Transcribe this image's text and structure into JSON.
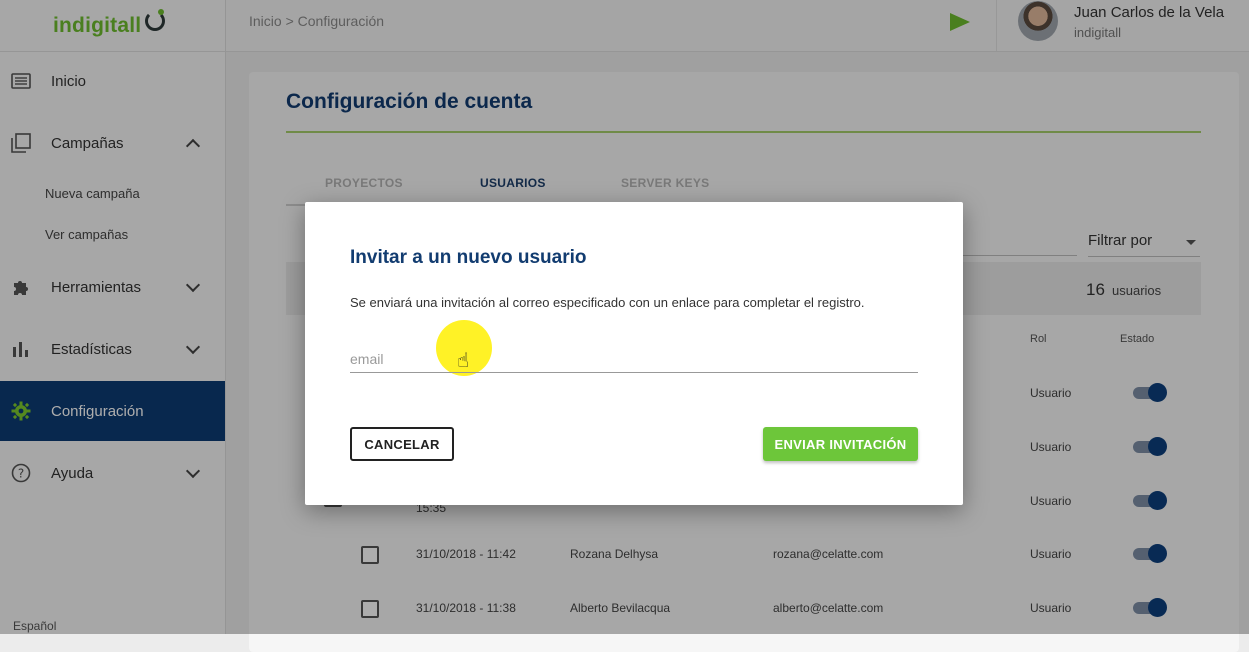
{
  "logo": {
    "text": "indigitall"
  },
  "breadcrumb": "Inicio > Configuración",
  "user": {
    "name": "Juan Carlos de la Vela",
    "org": "indigitall"
  },
  "sidebar": {
    "items": [
      {
        "label": "Inicio",
        "icon": "list-icon"
      },
      {
        "label": "Campañas",
        "icon": "copy-icon",
        "sub": [
          "Nueva campaña",
          "Ver campañas"
        ]
      },
      {
        "label": "Herramientas",
        "icon": "puzzle-icon"
      },
      {
        "label": "Estadísticas",
        "icon": "bar-chart-icon"
      },
      {
        "label": "Configuración",
        "icon": "gear-icon"
      },
      {
        "label": "Ayuda",
        "icon": "help-icon"
      }
    ],
    "language": "Español"
  },
  "main": {
    "title": "Configuración de cuenta",
    "tabs": [
      "PROYECTOS",
      "USUARIOS",
      "SERVER KEYS"
    ],
    "filter": "Filtrar por",
    "count": {
      "value": "16",
      "label": "usuarios"
    },
    "columns": {
      "rol": "Rol",
      "estado": "Estado"
    },
    "rows": [
      {
        "date": "",
        "name": "",
        "email": "",
        "rol": "Usuario",
        "active": true
      },
      {
        "date": "",
        "name": "",
        "email": "",
        "rol": "Usuario",
        "active": true
      },
      {
        "date": "15:35",
        "name": "",
        "email": "",
        "rol": "Usuario",
        "active": true
      },
      {
        "date": "31/10/2018 - 11:42",
        "name": "Rozana Delhysa",
        "email": "rozana@celatte.com",
        "rol": "Usuario",
        "active": true
      },
      {
        "date": "31/10/2018 - 11:38",
        "name": "Alberto Bevilacqua",
        "email": "alberto@celatte.com",
        "rol": "Usuario",
        "active": true
      }
    ]
  },
  "modal": {
    "title": "Invitar a un nuevo usuario",
    "description": "Se enviará una invitación al correo especificado con un enlace para completar el registro.",
    "email_placeholder": "email",
    "cancel_label": "CANCELAR",
    "send_label": "ENVIAR INVITACIÓN"
  },
  "colors": {
    "brand_green": "#6dbb2f",
    "navy": "#0c3b73"
  }
}
